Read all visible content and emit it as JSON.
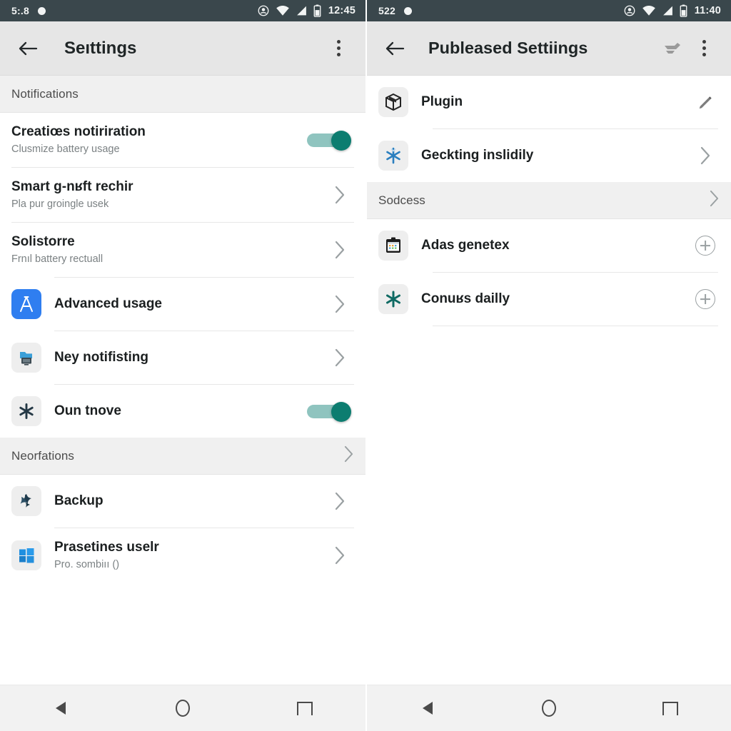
{
  "left_phone": {
    "status_bar": {
      "carrier_text": "5:.8",
      "dot_icon": "recording-dot-icon",
      "icons": [
        "cast-icon",
        "wifi-icon",
        "signal-icon",
        "battery-icon"
      ],
      "time": "12:45"
    },
    "app_bar": {
      "back_icon": "back-arrow-icon",
      "title": "Seıttings",
      "overflow_icon": "overflow-menu-icon"
    },
    "sections": [
      {
        "header": "Notifications",
        "has_chevron": false,
        "rows": [
          {
            "icon": "none",
            "title": "Creatiœs notiriration",
            "subtitle": "Clusmize battery usage",
            "control": "toggle",
            "toggle_on": true
          },
          {
            "icon": "none",
            "title": "Smart g-nʁft rechir",
            "subtitle": "Pla pur groingle usek",
            "control": "chevron"
          },
          {
            "icon": "none",
            "title": "Solistorre",
            "subtitle": "Frnıl battery rectuall",
            "control": "chevron"
          },
          {
            "icon": "app-a-icon",
            "title": "Advanced usage",
            "subtitle": "",
            "control": "chevron"
          },
          {
            "icon": "monitor-folder-icon",
            "title": "Ney notifisting",
            "subtitle": "",
            "control": "chevron"
          },
          {
            "icon": "asterisk-icon",
            "title": "Oun tnove",
            "subtitle": "",
            "control": "toggle",
            "toggle_on": true
          }
        ]
      },
      {
        "header": "Neorfations",
        "has_chevron": true,
        "rows": [
          {
            "icon": "star-burst-icon",
            "title": "Backup",
            "subtitle": "",
            "control": "chevron"
          },
          {
            "icon": "windows-logo-icon",
            "title": "Prasetines uselr",
            "subtitle": "Pro. sombiıı ()",
            "control": "chevron"
          }
        ]
      }
    ],
    "nav_bar": {
      "back": "nav-back-icon",
      "home": "nav-home-icon",
      "recents": "nav-recents-icon"
    }
  },
  "right_phone": {
    "status_bar": {
      "carrier_text": "522",
      "dot_icon": "recording-dot-icon",
      "icons": [
        "cast-icon",
        "wifi-icon",
        "signal-icon",
        "battery-icon"
      ],
      "time": "11:40"
    },
    "app_bar": {
      "back_icon": "back-arrow-icon",
      "title": "Publeased Settiings",
      "action_icon": "filter-edit-icon",
      "overflow_icon": "overflow-menu-icon"
    },
    "sections": [
      {
        "header": "",
        "has_chevron": false,
        "rows": [
          {
            "icon": "package-box-icon",
            "title": "Plugin",
            "subtitle": "",
            "control": "pencil"
          },
          {
            "icon": "snowflake-icon",
            "title": "Geckting inslidily",
            "subtitle": "",
            "control": "chevron"
          }
        ]
      },
      {
        "header": "Sodcess",
        "has_chevron": true,
        "rows": [
          {
            "icon": "clipboard-calendar-icon",
            "title": "Adas genetex",
            "subtitle": "",
            "control": "plus"
          },
          {
            "icon": "asterisk-teal-icon",
            "title": "Conuʁs dailly",
            "subtitle": "",
            "control": "plus"
          }
        ]
      }
    ],
    "nav_bar": {
      "back": "nav-back-icon",
      "home": "nav-home-icon",
      "recents": "nav-recents-icon"
    }
  },
  "colors": {
    "status_bar_bg": "#3a474c",
    "app_bar_bg": "#e6e6e6",
    "accent_teal": "#0c7d70",
    "toggle_track": "#8fc4bf",
    "section_bg": "#f0f0f0",
    "nav_bar_bg": "#f2f2f2",
    "blue_icon": "#2f7ef0",
    "chevron": "#9aa0a2"
  }
}
